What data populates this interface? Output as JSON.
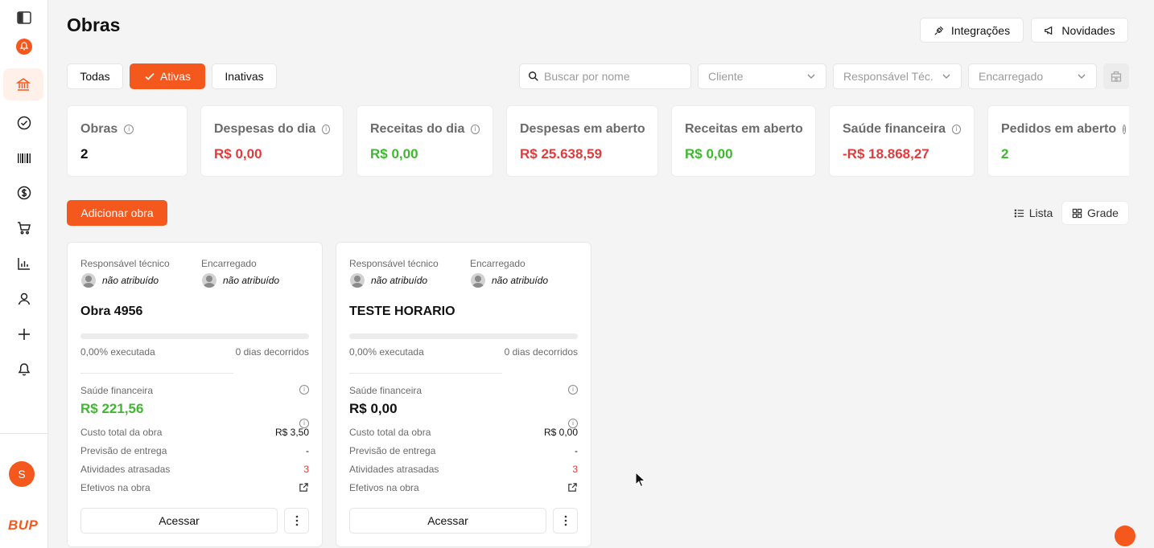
{
  "header": {
    "title": "Obras",
    "integrations_label": "Integrações",
    "news_label": "Novidades"
  },
  "filters": {
    "tabs": [
      {
        "label": "Todas",
        "active": false
      },
      {
        "label": "Ativas",
        "active": true
      },
      {
        "label": "Inativas",
        "active": false
      }
    ],
    "search_placeholder": "Buscar por nome",
    "client_placeholder": "Cliente",
    "tech_placeholder": "Responsável Téc.",
    "foreman_placeholder": "Encarregado"
  },
  "kpis": [
    {
      "label": "Obras",
      "value": "2",
      "info": true
    },
    {
      "label": "Despesas do dia",
      "value": "R$ 0,00",
      "info": true
    },
    {
      "label": "Receitas do dia",
      "value": "R$ 0,00",
      "info": true
    },
    {
      "label": "Despesas em aberto",
      "value": "R$ 25.638,59",
      "info": false
    },
    {
      "label": "Receitas em aberto",
      "value": "R$ 0,00",
      "info": false
    },
    {
      "label": "Saúde financeira",
      "value": "-R$ 18.868,27",
      "info": true
    },
    {
      "label": "Pedidos em aberto",
      "value": "2",
      "info": true
    }
  ],
  "actions": {
    "add_label": "Adicionar obra",
    "list_label": "Lista",
    "grid_label": "Grade"
  },
  "card_labels": {
    "tech": "Responsável técnico",
    "foreman": "Encarregado",
    "executed_suffix": "executada",
    "days_suffix": "dias decorridos",
    "health": "Saúde financeira",
    "total_cost": "Custo total da obra",
    "delivery": "Previsão de entrega",
    "late": "Atividades atrasadas",
    "workers": "Efetivos na obra",
    "access": "Acessar"
  },
  "cards": [
    {
      "tech_person": "não atribuído",
      "foreman_person": "não atribuído",
      "name": "Obra 4956",
      "progress_text": "0,00% executada",
      "progress": 0,
      "days_text": "0 dias decorridos",
      "health_value": "R$ 221,56",
      "total_cost": "R$ 3,50",
      "delivery": "-",
      "late": "3"
    },
    {
      "tech_person": "não atribuído",
      "foreman_person": "não atribuído",
      "name": "TESTE HORARIO",
      "progress_text": "0,00% executada",
      "progress": 0,
      "days_text": "0 dias decorridos",
      "health_value": "R$ 0,00",
      "total_cost": "R$ 0,00",
      "delivery": "-",
      "late": "3"
    }
  ],
  "user": {
    "initial": "S"
  },
  "brand": {
    "logo_text": "BUP"
  },
  "colors": {
    "accent": "#f4581c",
    "negative": "#e23b3b",
    "positive": "#3fb82f"
  }
}
